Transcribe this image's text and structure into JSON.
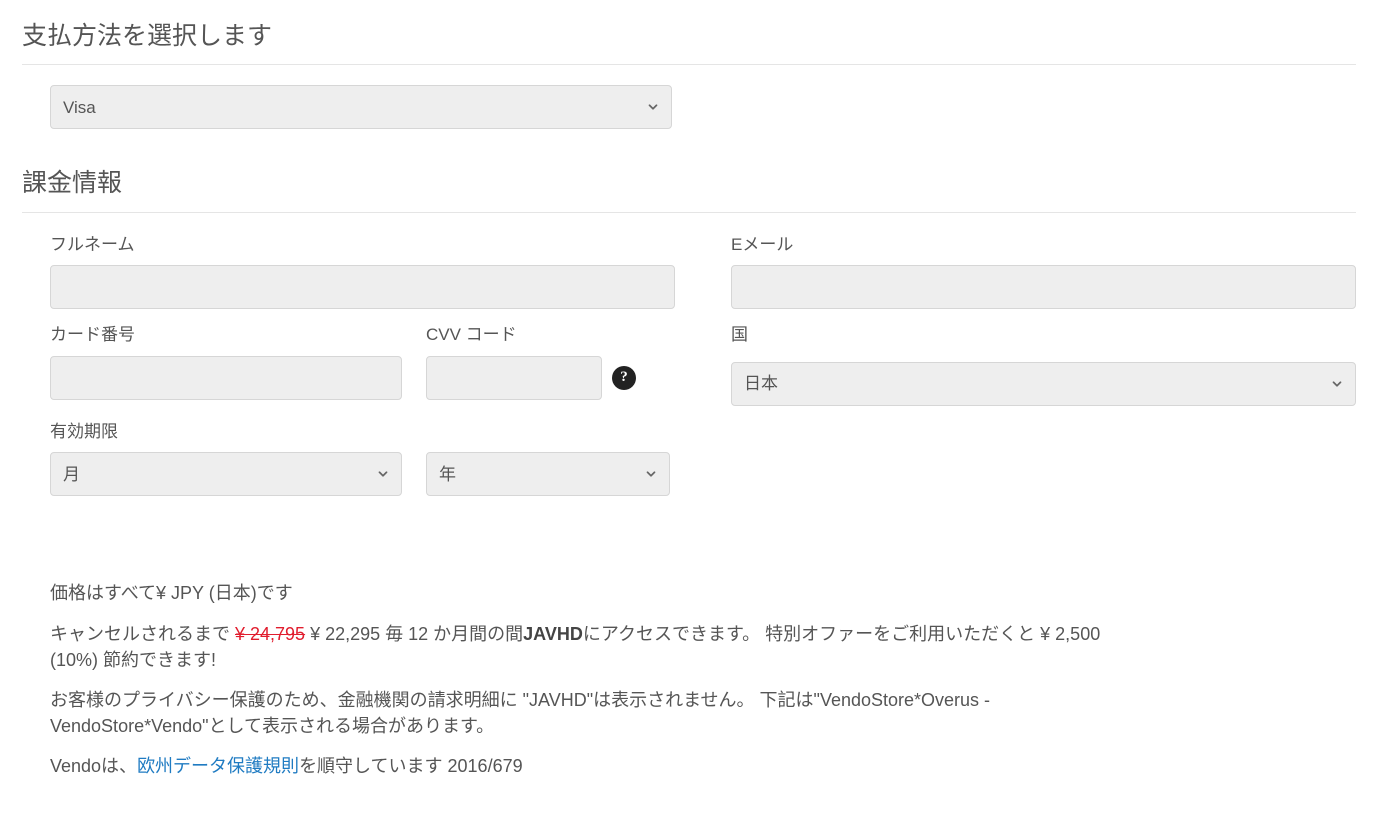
{
  "sections": {
    "payment_method_title": "支払方法を選択します",
    "billing_info_title": "課金情報"
  },
  "payment_method": {
    "selected": "Visa"
  },
  "billing": {
    "full_name_label": "フルネーム",
    "email_label": "Eメール",
    "card_number_label": "カード番号",
    "cvv_label": "CVV コード",
    "country_label": "国",
    "country_selected": "日本",
    "expiry_label": "有効期限",
    "month_selected": "月",
    "year_selected": "年"
  },
  "fineprint": {
    "currency_note": "価格はすべて¥ JPY (日本)です",
    "cancel_pre": "キャンセルされるまで ",
    "old_price": "¥ 24,795",
    "new_price": " ¥ 22,295 毎 12 か月間の間",
    "brand": "JAVHD",
    "access_post": "にアクセスできます。 特別オファーをご利用いただくと  ¥ 2,500",
    "savings_line2": "(10%) 節約できます!",
    "privacy_line1": "お客様のプライバシー保護のため、金融機関の請求明細に \"JAVHD\"は表示されません。 下記は\"VendoStore*Overus - ",
    "privacy_line2": "VendoStore*Vendo\"として表示される場合があります。",
    "vendo_pre": "Vendoは、",
    "gdpr_link": "欧州データ保護規則",
    "vendo_post": "を順守しています 2016/679"
  }
}
